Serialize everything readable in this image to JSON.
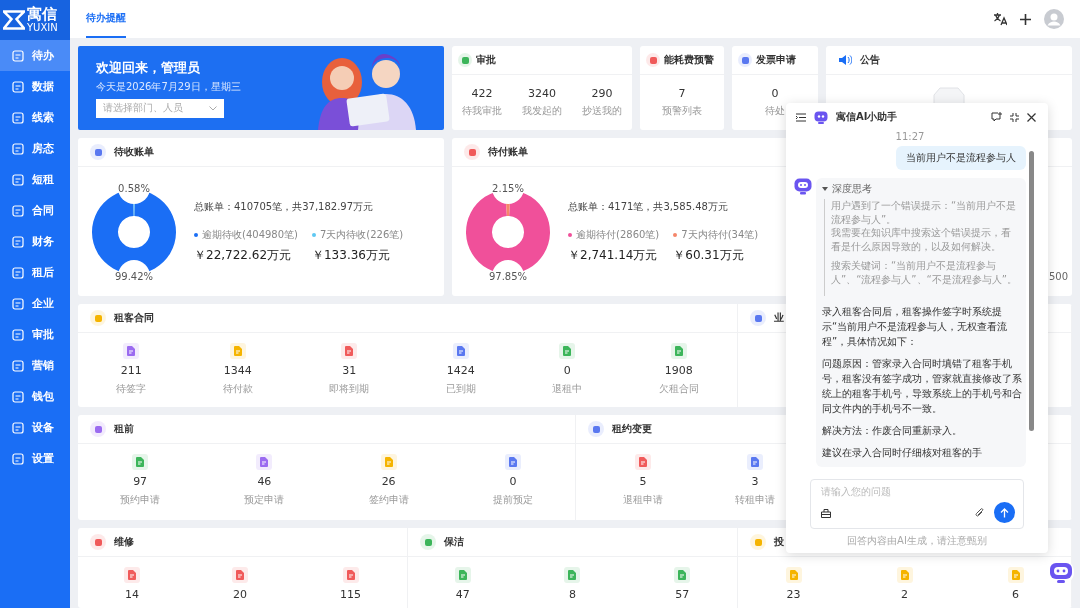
{
  "logo": {
    "name": "寓信",
    "sub": "YUXIN"
  },
  "top_tabs": [
    {
      "label": "待办提醒",
      "selected": true
    }
  ],
  "sidebar": {
    "items": [
      {
        "label": "待办",
        "selected": true
      },
      {
        "label": "数据",
        "selected": false
      },
      {
        "label": "线索",
        "selected": false
      },
      {
        "label": "房态",
        "selected": false
      },
      {
        "label": "短租",
        "selected": false
      },
      {
        "label": "合同",
        "selected": false
      },
      {
        "label": "财务",
        "selected": false
      },
      {
        "label": "租后",
        "selected": false
      },
      {
        "label": "企业",
        "selected": false
      },
      {
        "label": "审批",
        "selected": false
      },
      {
        "label": "营销",
        "selected": false
      },
      {
        "label": "钱包",
        "selected": false
      },
      {
        "label": "设备",
        "selected": false
      },
      {
        "label": "设置",
        "selected": false
      }
    ]
  },
  "welcome": {
    "title": "欢迎回来，管理员",
    "date": "今天是2026年7月29日，星期三",
    "select_placeholder": "请选择部门、人员"
  },
  "top_cards": [
    {
      "title": "审批",
      "color": "#3cb55a",
      "stats": [
        {
          "value": "422",
          "label": "待我审批"
        },
        {
          "value": "3240",
          "label": "我发起的"
        },
        {
          "value": "290",
          "label": "抄送我的"
        }
      ]
    },
    {
      "title": "能耗费预警",
      "color": "#f05a5a",
      "stats": [
        {
          "value": "7",
          "label": "预警列表"
        }
      ]
    },
    {
      "title": "发票申请",
      "color": "#5a78f0",
      "stats": [
        {
          "value": "0",
          "label": "待处"
        }
      ]
    }
  ],
  "announcement": {
    "title": "公告"
  },
  "bills": [
    {
      "title": "待收账单",
      "color": "#5a78f0",
      "total": "总账单：410705笔，共37,182.97万元",
      "legend": [
        {
          "label": "逾期待收(404980笔)",
          "amount": "￥22,722.62万元",
          "color": "#1a6ef5"
        },
        {
          "label": "7天内待收(226笔)",
          "amount": "￥133.36万元",
          "color": "#5ec8f2"
        }
      ],
      "chart_data": {
        "type": "donut",
        "values": [
          99.42,
          0.58
        ],
        "data_labels": true,
        "value_labels": [
          "99.42%",
          "0.58%"
        ]
      }
    },
    {
      "title": "待付账单",
      "color": "#f05a5a",
      "total": "总账单：4171笔，共3,585.48万元",
      "legend": [
        {
          "label": "逾期待付(2860笔)",
          "amount": "￥2,741.14万元",
          "color": "#f0509a"
        },
        {
          "label": "7天内待付(34笔)",
          "amount": "￥60.31万元",
          "color": "#f5866a"
        }
      ],
      "chart_data": {
        "type": "donut",
        "values": [
          97.85,
          2.15
        ],
        "data_labels": true,
        "value_labels": [
          "97.85%",
          "2.15%"
        ]
      },
      "side_reading": "500"
    }
  ],
  "section_rows": [
    {
      "sections": [
        {
          "title": "租客合同",
          "color": "#f5b400",
          "stats": [
            {
              "value": "211",
              "label": "待签字",
              "color": "#9b6bf0"
            },
            {
              "value": "1344",
              "label": "待付款",
              "color": "#f5b400"
            },
            {
              "value": "31",
              "label": "即将到期",
              "color": "#f05a5a"
            },
            {
              "value": "1424",
              "label": "已到期",
              "color": "#5a78f0"
            },
            {
              "value": "0",
              "label": "退租中",
              "color": "#3cb55a"
            },
            {
              "value": "1908",
              "label": "欠租合同",
              "color": "#3cb55a"
            }
          ]
        },
        {
          "title": "业",
          "color": "#5a78f0"
        }
      ]
    },
    {
      "sections": [
        {
          "title": "租前",
          "color": "#9b6bf0",
          "stats": [
            {
              "value": "97",
              "label": "预约申请",
              "color": "#3cb55a"
            },
            {
              "value": "46",
              "label": "预定申请",
              "color": "#9b6bf0"
            },
            {
              "value": "26",
              "label": "签约申请",
              "color": "#f5b400"
            },
            {
              "value": "0",
              "label": "提前预定",
              "color": "#5a78f0"
            }
          ]
        },
        {
          "title": "租约变更",
          "color": "#5a78f0",
          "stats": [
            {
              "value": "5",
              "label": "退租申请",
              "color": "#f05a5a"
            },
            {
              "value": "3",
              "label": "转租申请",
              "color": "#5a78f0"
            }
          ]
        }
      ]
    },
    {
      "sections": [
        {
          "title": "维修",
          "color": "#f05a5a",
          "stats": [
            {
              "value": "14",
              "color": "#f05a5a"
            },
            {
              "value": "20",
              "color": "#f05a5a"
            },
            {
              "value": "115",
              "color": "#f05a5a"
            }
          ]
        },
        {
          "title": "保洁",
          "color": "#3cb55a",
          "stats": [
            {
              "value": "47",
              "color": "#3cb55a"
            },
            {
              "value": "8",
              "color": "#3cb55a"
            },
            {
              "value": "57",
              "color": "#3cb55a"
            }
          ]
        },
        {
          "title": "投",
          "color": "#f5b400",
          "stats": [
            {
              "value": "23",
              "color": "#f5b400"
            },
            {
              "value": "2",
              "color": "#f5b400"
            },
            {
              "value": "6",
              "color": "#f5b400"
            }
          ]
        }
      ]
    }
  ],
  "assistant": {
    "title": "寓信AI小助手",
    "time": "11:27",
    "user_message": "当前用户不是流程参与人",
    "thinking": {
      "label": "深度思考",
      "expanded": true,
      "paragraphs": [
        "用户遇到了一个错误提示：“当前用户不是流程参与人”。",
        "我需要在知识库中搜索这个错误提示，看看是什么原因导致的，以及如何解决。",
        "搜索关键词：“当前用户不是流程参与人”、“流程参与人”、“不是流程参与人”。"
      ]
    },
    "answer": [
      "录入租客合同后，租客操作签字时系统提示“当前用户不是流程参与人，无权查看流程”，具体情况如下：",
      "问题原因：管家录入合同时填错了租客手机号，租客没有签字成功，管家就直接修改了系统上的租客手机号，导致系统上的手机号和合同文件内的手机号不一致。",
      "解决方法：作废合同重新录入。",
      "建议在录入合同时仔细核对租客的手"
    ],
    "input_placeholder": "请输入您的问题",
    "disclaimer": "回答内容由AI生成，请注意甄别"
  }
}
